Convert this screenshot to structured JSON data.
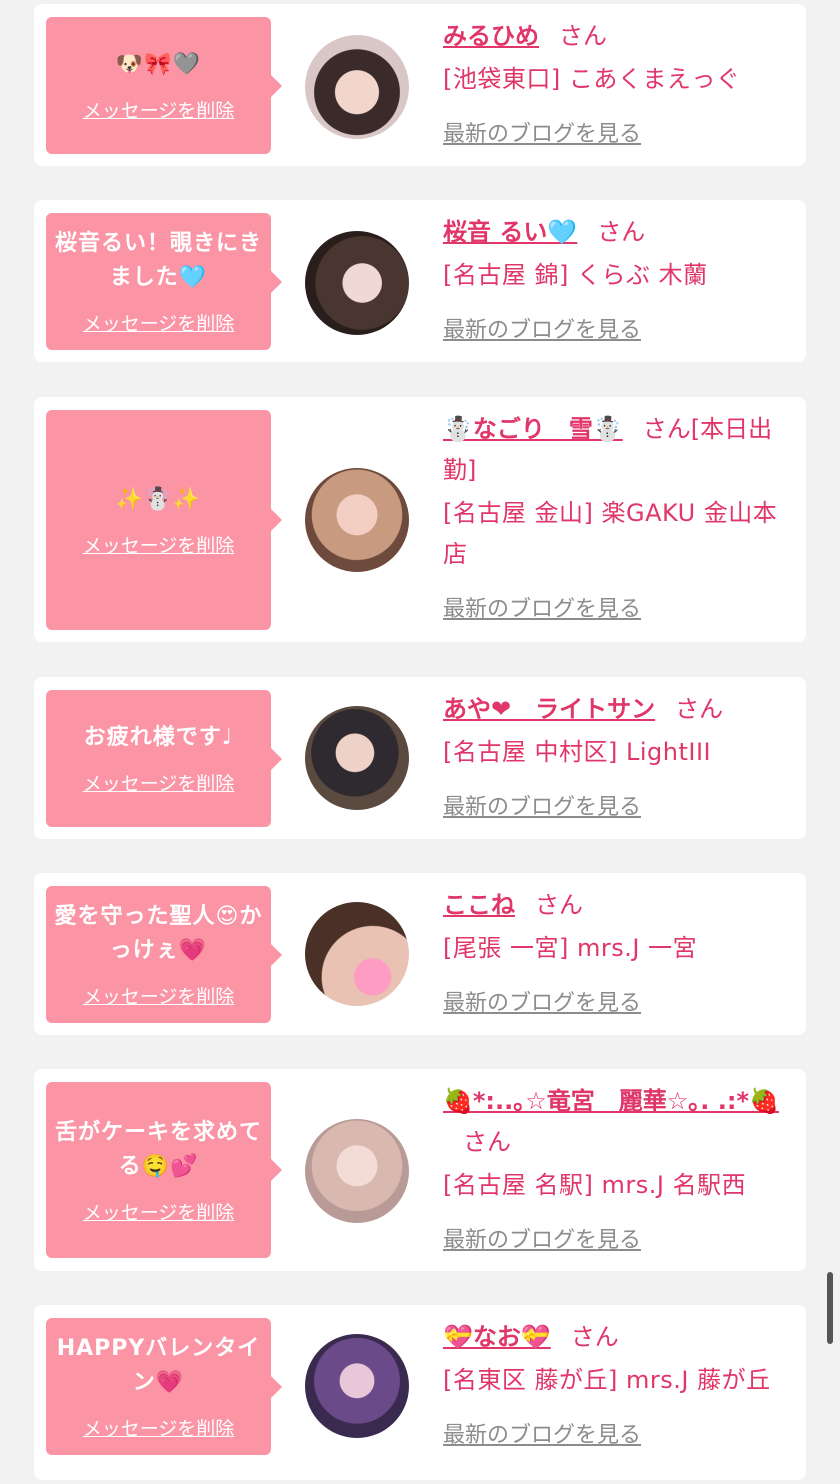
{
  "colors": {
    "accent": "#e0366a",
    "bubble": "#fb95a6",
    "link_gray": "#8c8c8c",
    "background": "#f2f2f2"
  },
  "cards": [
    {
      "message": "🐶🎀🩶",
      "delete_label": "メッセージを削除",
      "name": "みるひめ",
      "honorific": "さん",
      "shop": "[池袋東口] こあくまえっぐ",
      "blog_label": "最新のブログを見る",
      "avatar_icon": "avatar-photo"
    },
    {
      "message": "桜音るい！覗きにきました🩵",
      "delete_label": "メッセージを削除",
      "name": "桜音 るい🩵",
      "honorific": "さん",
      "shop": "[名古屋 錦] くらぶ 木蘭",
      "blog_label": "最新のブログを見る",
      "avatar_icon": "avatar-photo"
    },
    {
      "message": "✨☃️✨",
      "delete_label": "メッセージを削除",
      "name": "☃️なごり　雪☃️",
      "honorific": "さん[本日出勤]",
      "shop": "[名古屋 金山] 楽GAKU 金山本店",
      "blog_label": "最新のブログを見る",
      "avatar_icon": "avatar-photo"
    },
    {
      "message": "お疲れ様です♩",
      "delete_label": "メッセージを削除",
      "name": "あや❤︎　ライトサン",
      "honorific": "さん",
      "shop": "[名古屋 中村区] LightIII",
      "blog_label": "最新のブログを見る",
      "avatar_icon": "avatar-photo"
    },
    {
      "message": "愛を守った聖人😍かっけぇ💗",
      "delete_label": "メッセージを削除",
      "name": "ここね",
      "honorific": "さん",
      "shop": "[尾張 一宮] mrs.J 一宮",
      "blog_label": "最新のブログを見る",
      "avatar_icon": "avatar-photo"
    },
    {
      "message": "舌がケーキを求めてる🤤💕",
      "delete_label": "メッセージを削除",
      "name": "🍓*:..｡☆竜宮　麗華☆｡. .:*🍓",
      "honorific": "さん",
      "shop": "[名古屋 名駅] mrs.J 名駅西",
      "blog_label": "最新のブログを見る",
      "avatar_icon": "avatar-photo"
    },
    {
      "message": "HAPPYバレンタイン💗",
      "delete_label": "メッセージを削除",
      "name": "💝なお💝",
      "honorific": "さん",
      "shop": "[名東区 藤が丘] mrs.J 藤が丘",
      "blog_label": "最新のブログを見る",
      "avatar_icon": "avatar-photo"
    }
  ]
}
